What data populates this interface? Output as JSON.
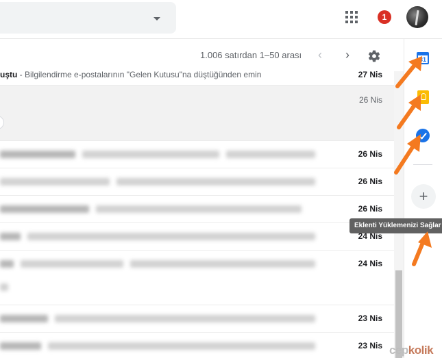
{
  "header": {
    "notification_count": "1"
  },
  "toolbar": {
    "range_text": "1.006 satırdan 1–50 arası",
    "prev_glyph": "‹",
    "next_glyph": "›"
  },
  "emails": [
    {
      "subject_bold": "uştu",
      "subject_rest": " - Bilgilendirme e-postalarının \"Gelen Kutusu\"na düştüğünden emin",
      "date": "27 Nis",
      "bold": true
    },
    {
      "date": "26 Nis",
      "bold": false
    },
    {
      "date": "26 Nis",
      "bold": true
    },
    {
      "date": "26 Nis",
      "bold": true
    },
    {
      "date": "26 Nis",
      "bold": true
    },
    {
      "date": "24 Nis",
      "bold": true
    },
    {
      "date": "24 Nis",
      "bold": true
    },
    {
      "date": "23 Nis",
      "bold": true
    },
    {
      "date": "23 Nis",
      "bold": true
    }
  ],
  "side_panel": {
    "calendar_day": "31",
    "add_glyph": "+",
    "tooltip": "Eklenti Yüklemenizi Sağlar"
  },
  "watermark": {
    "part1": "cep",
    "part2": "kolik"
  },
  "icons": {
    "apps": "apps-grid-icon",
    "settings": "gear-icon",
    "calendar": "calendar-icon",
    "keep": "keep-icon",
    "tasks": "tasks-icon"
  },
  "colors": {
    "notification_badge": "#d93025",
    "calendar": "#1a73e8",
    "keep": "#fbbc04",
    "tasks": "#1a73e8",
    "arrow": "#f47a20",
    "tooltip_bg": "#616161"
  }
}
